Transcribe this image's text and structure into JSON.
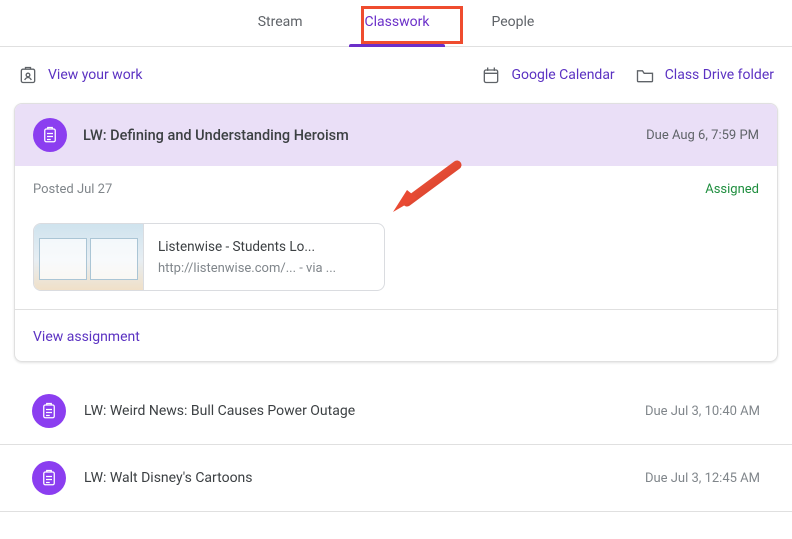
{
  "tabs": {
    "stream": "Stream",
    "classwork": "Classwork",
    "people": "People"
  },
  "toolbar": {
    "view_work": "View your work",
    "calendar": "Google Calendar",
    "drive": "Class Drive folder"
  },
  "assignment": {
    "title": "LW: Defining and Understanding Heroism",
    "due": "Due Aug 6, 7:59 PM",
    "posted": "Posted Jul 27",
    "status": "Assigned",
    "attachment": {
      "title": "Listenwise - Students Lo...",
      "url": "http://listenwise.com/...  - via ..."
    },
    "view": "View assignment"
  },
  "list": [
    {
      "title": "LW: Weird News: Bull Causes Power Outage",
      "due": "Due Jul 3, 10:40 AM"
    },
    {
      "title": "LW: Walt Disney's Cartoons",
      "due": "Due Jul 3, 12:45 AM"
    }
  ]
}
